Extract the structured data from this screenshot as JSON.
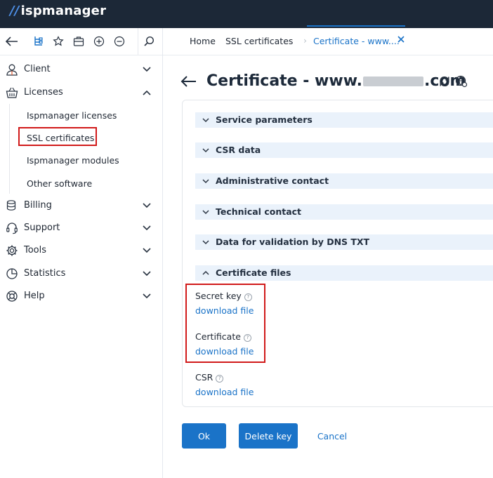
{
  "app": {
    "logo_text": "ispmanager",
    "logo_mark": "//"
  },
  "toolbar": {
    "icons": [
      "back-arrow-icon",
      "tree-icon",
      "star-icon",
      "briefcase-icon",
      "plus-circle-icon",
      "minus-circle-icon",
      "search-icon"
    ]
  },
  "sidebar": {
    "items": [
      {
        "label": "Client",
        "icon": "user-icon",
        "expanded": false
      },
      {
        "label": "Licenses",
        "icon": "basket-icon",
        "expanded": true
      },
      {
        "label": "Billing",
        "icon": "database-icon",
        "expanded": false
      },
      {
        "label": "Support",
        "icon": "headset-icon",
        "expanded": false
      },
      {
        "label": "Tools",
        "icon": "gear-icon",
        "expanded": false
      },
      {
        "label": "Statistics",
        "icon": "pie-chart-icon",
        "expanded": false
      },
      {
        "label": "Help",
        "icon": "lifebuoy-icon",
        "expanded": false
      }
    ],
    "licenses_sub": [
      "Ispmanager licenses",
      "SSL certificates",
      "Ispmanager modules",
      "Other software"
    ],
    "active_sub": "SSL certificates"
  },
  "tabs": [
    {
      "label": "Home",
      "active": false
    },
    {
      "label": "SSL certificates",
      "active": false
    },
    {
      "label": "Certificate - www....",
      "active": true
    }
  ],
  "page": {
    "title_prefix": "Certificate - www.",
    "title_suffix": ".com"
  },
  "sections": [
    {
      "label": "Service parameters",
      "expanded": false
    },
    {
      "label": "CSR data",
      "expanded": false
    },
    {
      "label": "Administrative contact",
      "expanded": false
    },
    {
      "label": "Technical contact",
      "expanded": false
    },
    {
      "label": "Data for validation by DNS TXT",
      "expanded": false
    },
    {
      "label": "Certificate files",
      "expanded": true
    }
  ],
  "files": [
    {
      "label": "Secret key",
      "help": "?",
      "link": "download file"
    },
    {
      "label": "Certificate",
      "help": "?",
      "link": "download file"
    },
    {
      "label": "CSR",
      "help": "?",
      "link": "download file"
    }
  ],
  "buttons": {
    "ok": "Ok",
    "delete_key": "Delete key",
    "cancel": "Cancel"
  },
  "colors": {
    "accent": "#1a73c8",
    "topbar": "#1c2837",
    "highlight": "#d11a1a",
    "section_bg": "#eaf2fb"
  }
}
